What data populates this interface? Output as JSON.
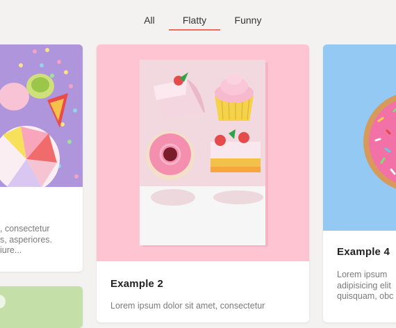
{
  "filters": {
    "tabs": [
      {
        "label": "All"
      },
      {
        "label": "Flatty"
      },
      {
        "label": "Funny"
      }
    ],
    "active": "Flatty",
    "accent_color": "#f06b5f"
  },
  "cards": [
    {
      "title": "",
      "desc_lines": [
        ", consectetur",
        "s, asperiores.",
        "iure..."
      ]
    },
    {
      "title": "Example 2",
      "desc_lines": [
        "Lorem ipsum dolor sit amet, consectetur"
      ]
    },
    {
      "title": "Example 4",
      "desc_lines": [
        "Lorem ipsum",
        "adipisicing elit",
        "quisquam, obc"
      ]
    }
  ]
}
